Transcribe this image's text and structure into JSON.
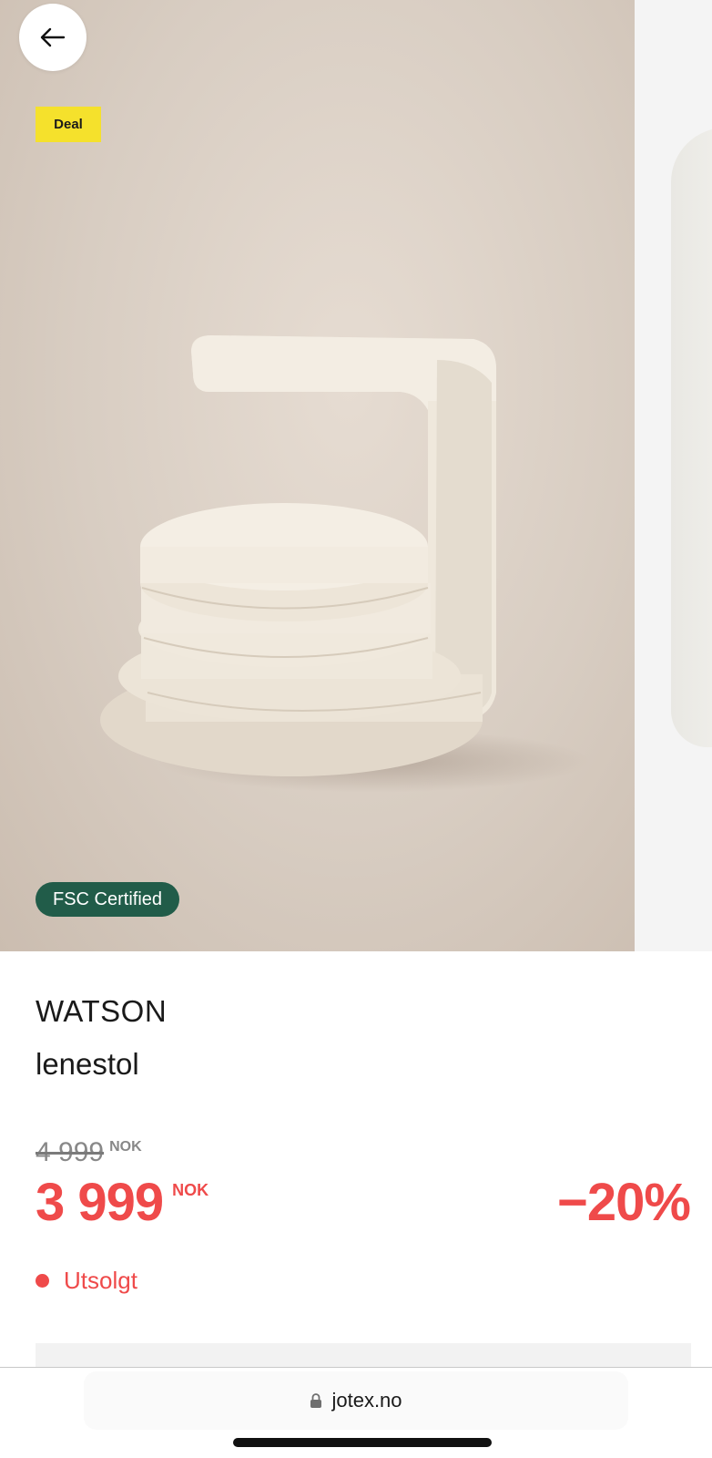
{
  "gallery": {
    "badges": {
      "deal": "Deal",
      "certification": "FSC Certified"
    },
    "back_icon": "arrow-left-icon"
  },
  "product": {
    "brand": "WATSON",
    "type": "lenestol",
    "old_price": "4 999",
    "old_currency": "NOK",
    "price": "3 999",
    "currency": "NOK",
    "discount": "−20%",
    "stock_status": "Utsolgt"
  },
  "browser": {
    "url": "jotex.no",
    "lock_icon": "lock-icon"
  },
  "colors": {
    "accent_red": "#ef4a4a",
    "deal_yellow": "#f5e12c",
    "fsc_green": "#215c49"
  }
}
